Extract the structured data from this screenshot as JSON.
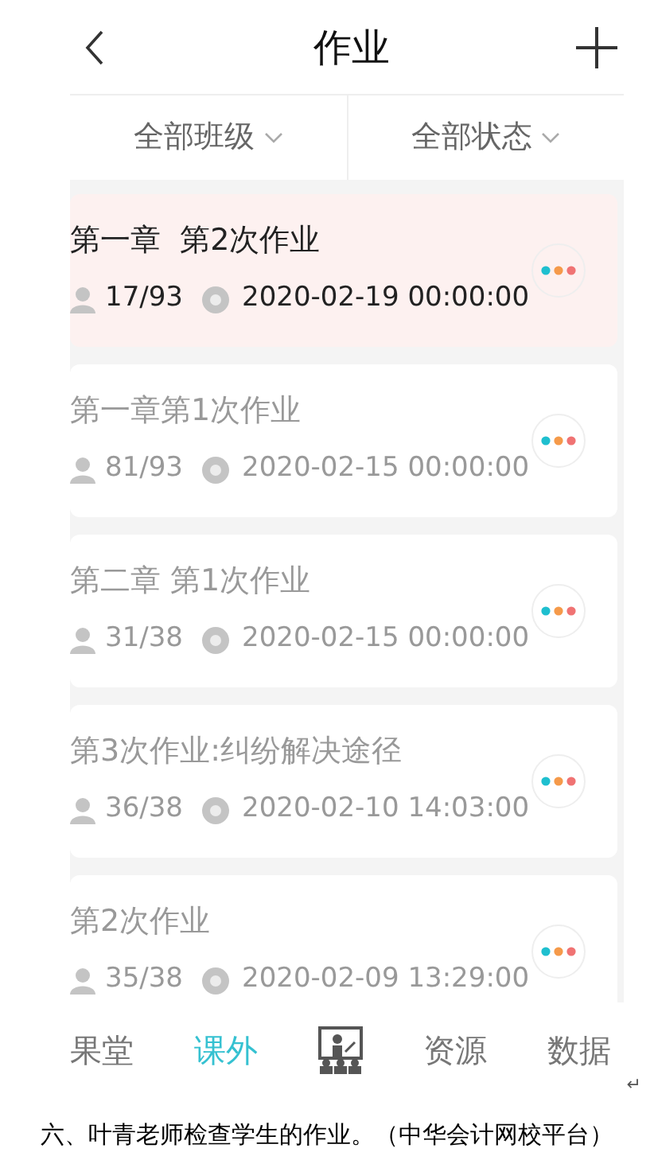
{
  "header": {
    "title": "作业"
  },
  "filters": [
    {
      "label": "全部班级"
    },
    {
      "label": "全部状态"
    }
  ],
  "assignments": [
    {
      "title": "第一章  第2次作业",
      "count": "17/93",
      "due": "2020-02-19 00:00:00",
      "selected": true
    },
    {
      "title": "第一章第1次作业",
      "count": "81/93",
      "due": "2020-02-15 00:00:00",
      "selected": false
    },
    {
      "title": "第二章 第1次作业",
      "count": "31/38",
      "due": "2020-02-15 00:00:00",
      "selected": false
    },
    {
      "title": "第3次作业:纠纷解决途径",
      "count": "36/38",
      "due": "2020-02-10 14:03:00",
      "selected": false
    },
    {
      "title": "第2次作业",
      "count": "35/38",
      "due": "2020-02-09 13:29:00",
      "selected": false
    }
  ],
  "bottom_nav": [
    {
      "kind": "text",
      "label": "果堂",
      "selected": false
    },
    {
      "kind": "text",
      "label": "课外",
      "selected": true
    },
    {
      "kind": "icon",
      "selected": false
    },
    {
      "kind": "text",
      "label": "资源",
      "selected": false
    },
    {
      "kind": "text",
      "label": "数据",
      "selected": false
    }
  ],
  "paragraph_mark": "↵",
  "caption": "六、叶青老师检查学生的作业。（中华会计网校平台）"
}
